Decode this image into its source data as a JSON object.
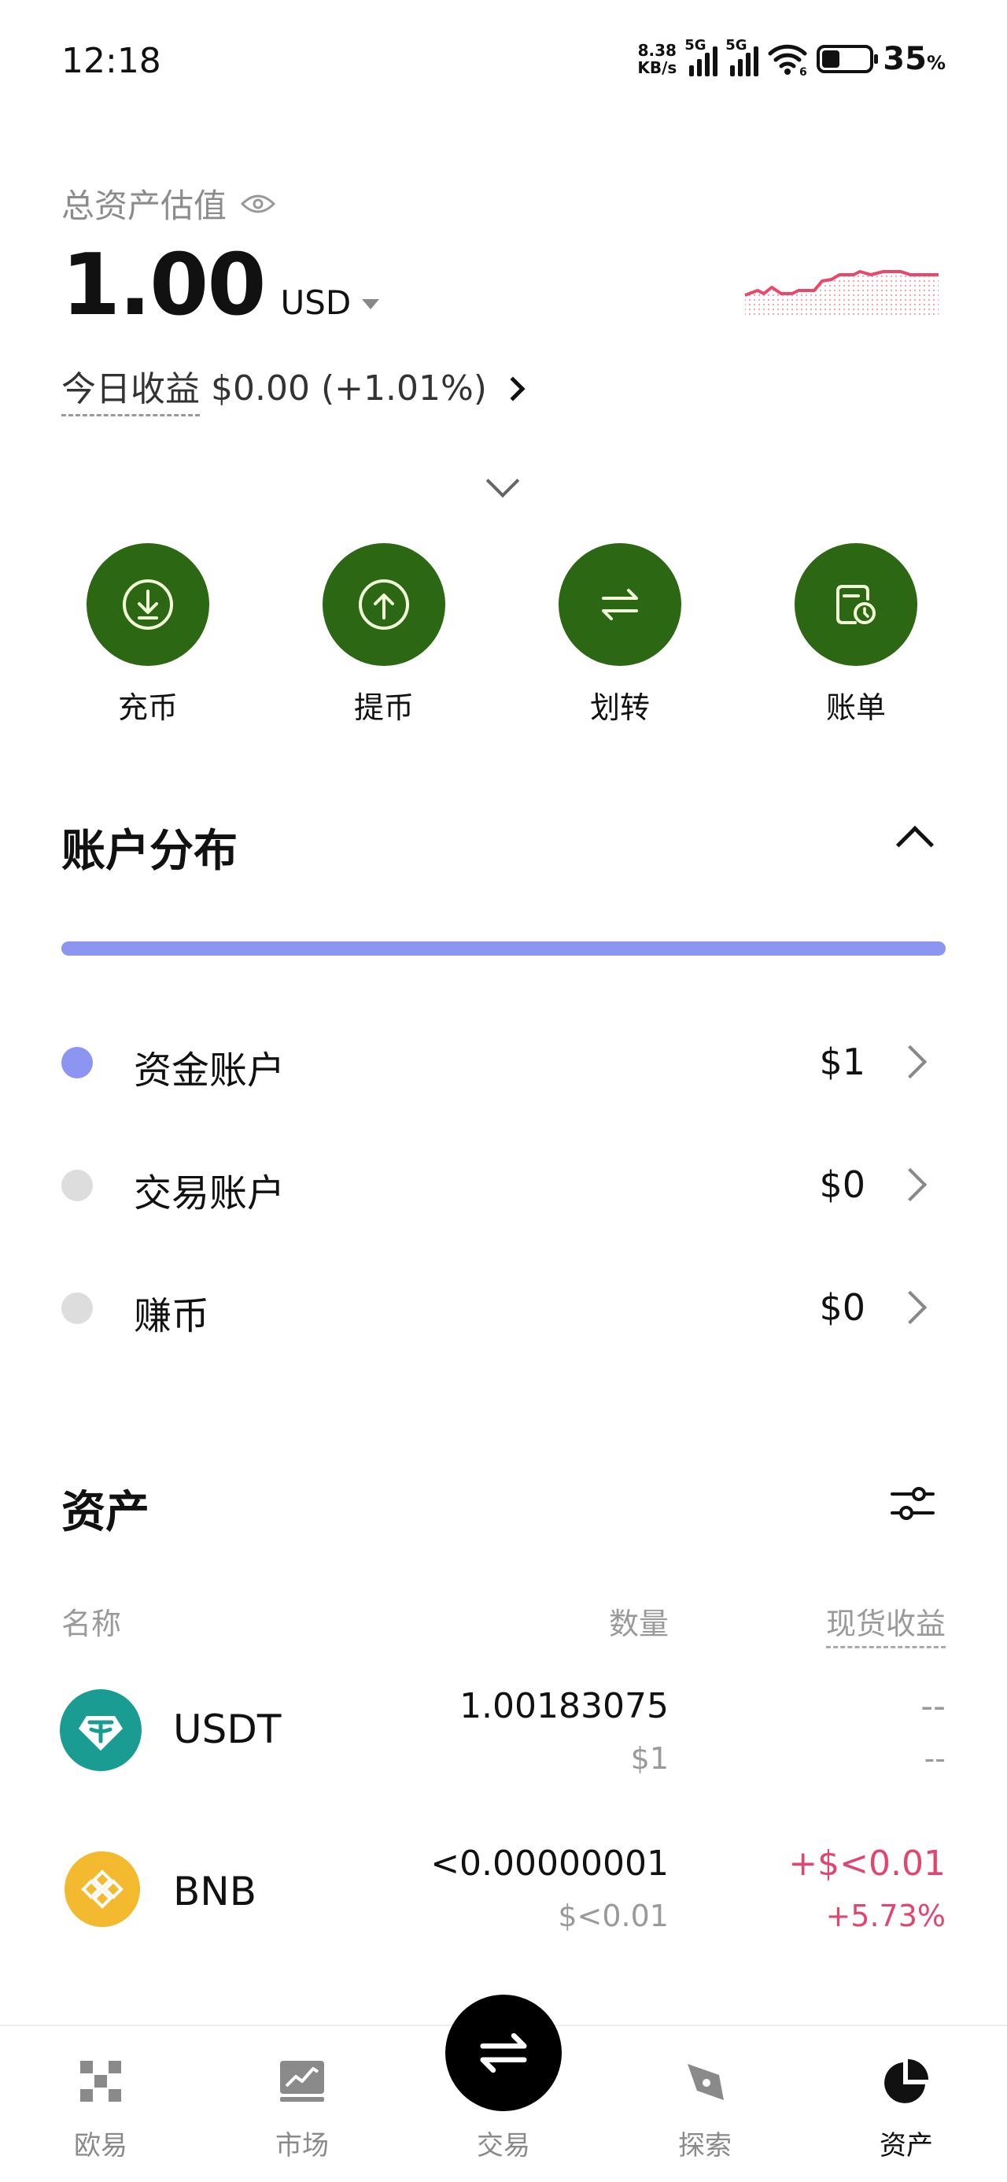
{
  "status_bar": {
    "time": "12:18",
    "net_speed_value": "8.38",
    "net_speed_unit": "KB/s",
    "sim1_tag": "5G",
    "sim2_tag": "5G",
    "wifi_tag": "6",
    "battery_percent": "35",
    "battery_unit": "%"
  },
  "header": {
    "total_label": "总资产估值",
    "balance": "1.00",
    "currency": "USD",
    "today_label": "今日收益",
    "today_value": "$0.00 (+1.01%)",
    "spark_color": "#e8496b"
  },
  "actions": [
    {
      "label": "充币",
      "icon": "deposit-icon"
    },
    {
      "label": "提币",
      "icon": "withdraw-icon"
    },
    {
      "label": "划转",
      "icon": "transfer-icon"
    },
    {
      "label": "账单",
      "icon": "bill-icon"
    }
  ],
  "distribution": {
    "title": "账户分布",
    "bar_color": "#8d95f2",
    "accounts": [
      {
        "name": "资金账户",
        "value": "$1",
        "dot_color": "#8d95f2"
      },
      {
        "name": "交易账户",
        "value": "$0",
        "dot_color": "#dddddd"
      },
      {
        "name": "赚币",
        "value": "$0",
        "dot_color": "#dddddd"
      }
    ]
  },
  "assets": {
    "title": "资产",
    "columns": {
      "name": "名称",
      "quantity": "数量",
      "spot_pnl": "现货收益"
    },
    "rows": [
      {
        "symbol": "USDT",
        "qty": "1.00183075",
        "qty_usd": "$1",
        "pnl": "--",
        "pnl_pct": "--",
        "logo_color": "#1a9c92",
        "pnl_color": "#9a9a9a"
      },
      {
        "symbol": "BNB",
        "qty": "<0.00000001",
        "qty_usd": "$<0.01",
        "pnl": "+$<0.01",
        "pnl_pct": "+5.73%",
        "logo_color": "#f3ba2f",
        "pnl_color": "#e0466f"
      }
    ]
  },
  "tabbar": {
    "tabs": [
      {
        "label": "欧易",
        "icon": "okx-logo-icon"
      },
      {
        "label": "市场",
        "icon": "market-chart-icon"
      },
      {
        "label": "交易",
        "icon": "trade-swap-icon"
      },
      {
        "label": "探索",
        "icon": "explore-compass-icon"
      },
      {
        "label": "资产",
        "icon": "assets-pie-icon"
      }
    ],
    "active": "资产"
  }
}
